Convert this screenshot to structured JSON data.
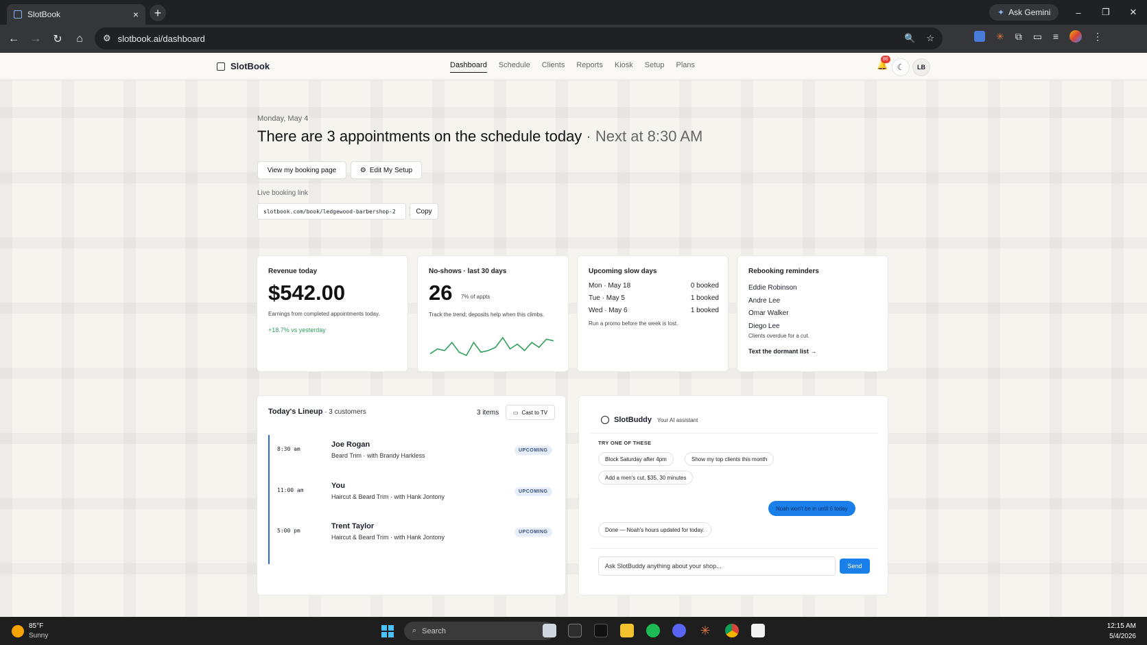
{
  "browser": {
    "tab_title": "SlotBook",
    "tab_close": "×",
    "new_tab": "+",
    "ask_gemini": "Ask Gemini",
    "url": "slotbook.ai/dashboard",
    "win_min": "–",
    "win_max": "❐",
    "win_close": "✕"
  },
  "app": {
    "brand": "SlotBook",
    "nav": [
      "Dashboard",
      "Schedule",
      "Clients",
      "Reports",
      "Kiosk",
      "Setup",
      "Plans"
    ],
    "notif_count": "86",
    "user_initials": "LB"
  },
  "hero": {
    "date": "Monday, May 4",
    "headline": "There are 3 appointments on the schedule today",
    "headline_sub": " · Next at 8:30 AM",
    "view_booking_btn": "View my booking page",
    "edit_setup_btn": "Edit My Setup",
    "live_link_label": "Live booking link",
    "live_link": "slotbook.com/book/ledgewood-barbershop-2",
    "copy_btn": "Copy"
  },
  "cards": {
    "revenue": {
      "title": "Revenue today",
      "value": "$542.00",
      "desc": "Earnings from completed appointments today.",
      "delta": "+18.7% vs yesterday"
    },
    "noshows": {
      "title": "No-shows · last 30 days",
      "value": "26",
      "pct": "7% of appts",
      "desc": "Track the trend; deposits help when this climbs.",
      "trend": [
        2,
        5,
        4,
        9,
        3,
        1,
        9,
        3,
        4,
        6,
        12,
        5,
        8,
        4,
        9,
        6,
        11,
        10
      ]
    },
    "slow_days": {
      "title": "Upcoming slow days",
      "rows": [
        {
          "day": "Mon · May 18",
          "booked": "0 booked"
        },
        {
          "day": "Tue · May 5",
          "booked": "1 booked"
        },
        {
          "day": "Wed · May 6",
          "booked": "1 booked"
        }
      ],
      "note": "Run a promo before the week is lost."
    },
    "rebooking": {
      "title": "Rebooking reminders",
      "names": [
        "Eddie Robinson",
        "Andre Lee",
        "Omar Walker",
        "Diego Lee"
      ],
      "note": "Clients overdue for a cut.",
      "action": "Text the dormant list →"
    }
  },
  "lineup": {
    "title": "Today's Lineup",
    "subtitle": " · 3 customers",
    "count": "3 items",
    "cast_btn": "Cast to TV",
    "items": [
      {
        "time": "8:30 am",
        "name": "Joe Rogan",
        "service": "Beard Trim  · with Brandy Harkless",
        "status": "UPCOMING"
      },
      {
        "time": "11:00 am",
        "name": "You",
        "service": "Haircut & Beard Trim  · with Hank Jontony",
        "status": "UPCOMING"
      },
      {
        "time": "5:00 pm",
        "name": "Trent Taylor",
        "service": "Haircut & Beard Trim  · with Hank Jontony",
        "status": "UPCOMING"
      }
    ]
  },
  "assistant": {
    "name": "SlotBuddy",
    "tagline": "Your AI assistant",
    "try_label": "TRY ONE OF THESE",
    "chips": [
      "Block Saturday after 4pm",
      "Show my top clients this month",
      "Add a men's cut, $35, 30 minutes"
    ],
    "user_msg": "Noah won't be in until 6 today",
    "bot_msg": "Done — Noah's hours updated for today.",
    "input_placeholder": "Ask SlotBuddy anything about your shop...",
    "send_btn": "Send",
    "accent": "#1a7fe8"
  },
  "taskbar": {
    "temp": "85°F",
    "weather": "Sunny",
    "search": "Search",
    "time": "12:15 AM",
    "date": "5/4/2026"
  }
}
